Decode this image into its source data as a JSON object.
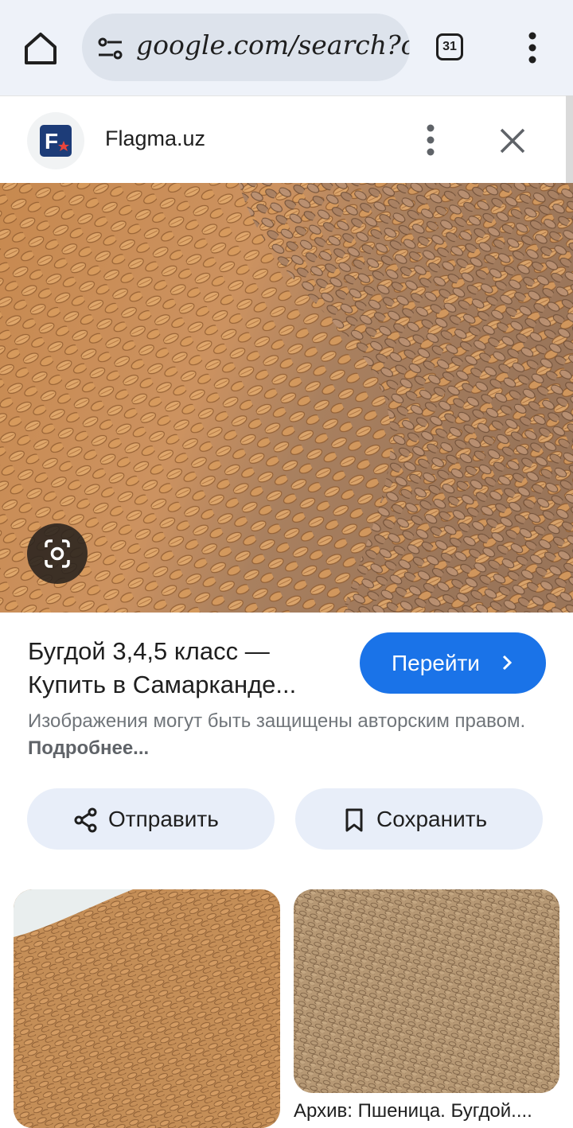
{
  "browser": {
    "url": "google.com/search?c",
    "tab_count": "31",
    "icons": [
      "home-icon",
      "tune-icon",
      "tab-switcher-icon",
      "more-vert-icon"
    ]
  },
  "sheet": {
    "site_name": "Flagma.uz",
    "logo_letter": "F",
    "icons": [
      "more-vert-icon",
      "close-icon",
      "google-lens-icon"
    ]
  },
  "result": {
    "title": "Бугдой 3,4,5 класс — Купить в Самарканде...",
    "visit_label": "Перейти",
    "copyright_text": "Изображения могут быть защищены авторским правом.",
    "learn_more": "Подробнее...",
    "share_label": "Отправить",
    "save_label": "Сохранить"
  },
  "related": {
    "caption_2": "Архив: Пшеница. Бугдой...."
  },
  "colors": {
    "accent": "#1a73e8",
    "pill_bg": "#e8eef9",
    "toolbar_bg": "#eef2f9"
  }
}
